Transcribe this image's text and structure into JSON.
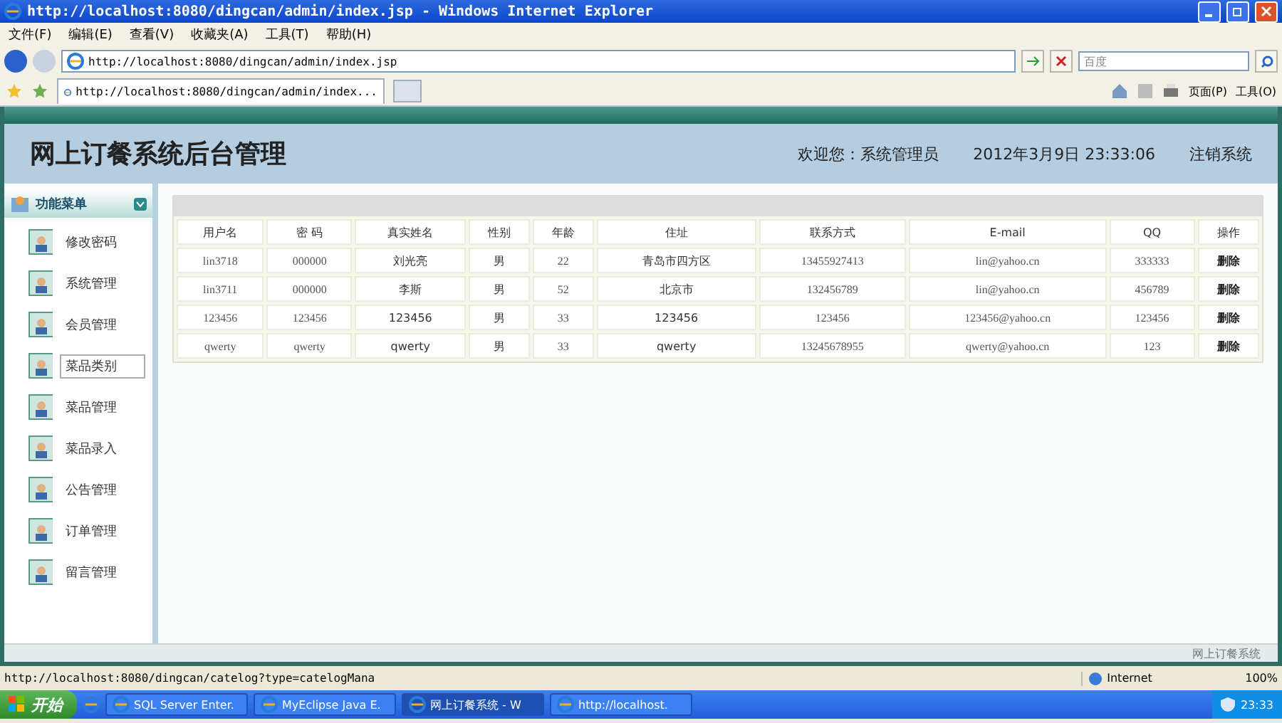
{
  "window": {
    "title": "http://localhost:8080/dingcan/admin/index.jsp - Windows Internet Explorer"
  },
  "menu_bar": [
    "文件(F)",
    "编辑(E)",
    "查看(V)",
    "收藏夹(A)",
    "工具(T)",
    "帮助(H)"
  ],
  "address_bar": {
    "value": "http://localhost:8080/dingcan/admin/index.jsp"
  },
  "search": {
    "placeholder": "百度"
  },
  "tabs": [
    {
      "label": "http://localhost:8080/dingcan/admin/index...",
      "selected": true
    }
  ],
  "command_bar": [
    "页面(P)",
    "工具(O)"
  ],
  "header": {
    "title": "网上订餐系统后台管理",
    "welcome": "欢迎您：系统管理员",
    "datetime": "2012年3月9日 23:33:06",
    "logout": "注销系统"
  },
  "sidebar": {
    "title": "功能菜单",
    "items": [
      {
        "label": "修改密码",
        "selected": false
      },
      {
        "label": "系统管理",
        "selected": false
      },
      {
        "label": "会员管理",
        "selected": false
      },
      {
        "label": "菜品类别",
        "selected": true
      },
      {
        "label": "菜品管理",
        "selected": false
      },
      {
        "label": "菜品录入",
        "selected": false
      },
      {
        "label": "公告管理",
        "selected": false
      },
      {
        "label": "订单管理",
        "selected": false
      },
      {
        "label": "留言管理",
        "selected": false
      }
    ]
  },
  "table": {
    "columns": [
      "用户名",
      "密 码",
      "真实姓名",
      "性别",
      "年龄",
      "住址",
      "联系方式",
      "E-mail",
      "QQ",
      "操作"
    ],
    "rows": [
      [
        "lin3718",
        "000000",
        "刘光亮",
        "男",
        "22",
        "青岛市四方区",
        "13455927413",
        "lin@yahoo.cn",
        "333333",
        "删除"
      ],
      [
        "lin3711",
        "000000",
        "李斯",
        "男",
        "52",
        "北京市",
        "132456789",
        "lin@yahoo.cn",
        "456789",
        "删除"
      ],
      [
        "123456",
        "123456",
        "123456",
        "男",
        "33",
        "123456",
        "123456",
        "123456@yahoo.cn",
        "123456",
        "删除"
      ],
      [
        "qwerty",
        "qwerty",
        "qwerty",
        "男",
        "33",
        "qwerty",
        "13245678955",
        "qwerty@yahoo.cn",
        "123",
        "删除"
      ]
    ]
  },
  "footer": "网上订餐系统",
  "status_bar": {
    "url": "http://localhost:8080/dingcan/catelog?type=catelogMana",
    "zone": "Internet",
    "zoom": "100%"
  },
  "taskbar": {
    "start": "开始",
    "tasks": [
      {
        "label": "SQL Server Enter.",
        "selected": false
      },
      {
        "label": "MyEclipse Java E.",
        "selected": false
      },
      {
        "label": "网上订餐系统 - W",
        "selected": true
      },
      {
        "label": "http://localhost.",
        "selected": false
      }
    ],
    "clock": "23:33"
  }
}
